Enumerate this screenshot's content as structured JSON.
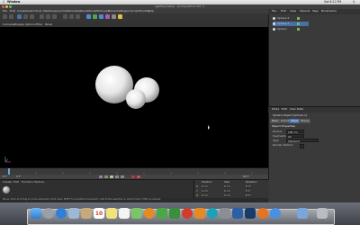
{
  "mac_menubar": {
    "app_name": "Window",
    "clock": "Sat 6:21 PM"
  },
  "window": {
    "title": "Lighting Setup - [Composition.c4d *]"
  },
  "c4d_menu": {
    "items": [
      "File",
      "Edit",
      "Create",
      "Select",
      "Tools",
      "Mesh",
      "Snap",
      "Animate",
      "Simulate",
      "Render",
      "Sculpt",
      "MoGraph",
      "Character",
      "Plugins",
      "Script",
      "Window",
      "Help"
    ]
  },
  "viewport_menu": {
    "items": [
      "Cameras",
      "Display",
      "Options",
      "Filter",
      "Panel"
    ]
  },
  "objects_panel": {
    "tabs": [
      "File",
      "Edit",
      "View",
      "Objects",
      "Tags",
      "Bookmarks"
    ],
    "rows": [
      {
        "name": "Sphere.2"
      },
      {
        "name": "Sphere.1"
      },
      {
        "name": "Sphere"
      }
    ]
  },
  "attributes_panel": {
    "header_tabs": [
      "Mode",
      "Edit",
      "User Data"
    ],
    "object_title": "Sphere Object [Sphere.1]",
    "sub_tabs": [
      "Basic",
      "Coord.",
      "Object",
      "Phong"
    ],
    "section": "Object Properties",
    "fields": [
      {
        "label": "Radius",
        "value": "100 cm"
      },
      {
        "label": "Segments",
        "value": "24"
      },
      {
        "label": "Type",
        "value": "Standard"
      },
      {
        "label": "Render Perfect",
        "value": ""
      }
    ]
  },
  "timeline": {
    "frame_start": "0 F",
    "frame_end": "90 F",
    "current_frame": "0 F"
  },
  "materials": {
    "tabs": [
      "Create",
      "Edit",
      "Function",
      "Texture"
    ]
  },
  "coordinates": {
    "headers": [
      "Position",
      "Size",
      "Rotation"
    ],
    "rows": [
      {
        "axis": "X",
        "pos": "0 cm",
        "size": "0 cm",
        "rot": "H 0°"
      },
      {
        "axis": "Y",
        "pos": "0 cm",
        "size": "0 cm",
        "rot": "P 0°"
      },
      {
        "axis": "Z",
        "pos": "0 cm",
        "size": "0 cm",
        "rot": "B 0°"
      }
    ],
    "mode_object": "Object (Rel)",
    "mode_size": "Size",
    "apply_label": "Apply"
  },
  "status": {
    "text": "Move: Click and drag to move elements. Hold down SHIFT to quantize movement / add to the selection in point mode, CTRL to remove."
  },
  "dock": {
    "icons": [
      "finder-icon",
      "launchpad-icon",
      "safari-icon",
      "mail-icon",
      "contacts-icon",
      "calendar-icon",
      "notes-icon",
      "reminders-icon",
      "maps-icon",
      "photos-icon",
      "messages-icon",
      "facetime-icon",
      "itunes-icon",
      "ibooks-icon",
      "appstore-icon",
      "preferences-icon",
      "cinema4d-icon",
      "photoshop-icon",
      "firefox-icon",
      "chrome-icon",
      "downloads-icon",
      "trash-icon"
    ],
    "calendar_day": "10",
    "colors": {
      "blue": "#2f7fd8",
      "teal": "#1ea1b8",
      "red": "#d33b2c",
      "green": "#49a745",
      "orange": "#e88a22",
      "gray": "#9aa0a8"
    }
  },
  "colors": {
    "accent_selection": "#4a6fa5",
    "viewport_bg": "#000000",
    "panel_bg": "#3a3a3a"
  }
}
